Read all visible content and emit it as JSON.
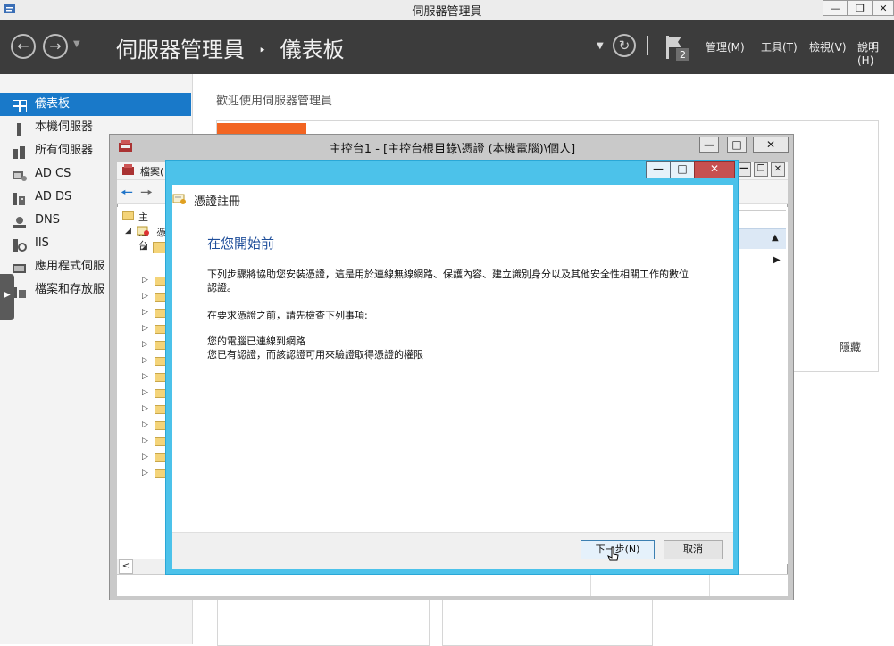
{
  "server_manager": {
    "window_title": "伺服器管理員",
    "breadcrumb_root": "伺服器管理員",
    "breadcrumb_sep": "‣",
    "breadcrumb_current": "儀表板",
    "notification_count": "2",
    "menu": [
      "管理(M)",
      "工具(T)",
      "檢視(V)",
      "說明(H)"
    ],
    "sidebar": [
      {
        "label": "儀表板",
        "icon": "dashboard-icon",
        "active": true
      },
      {
        "label": "本機伺服器",
        "icon": "server-icon"
      },
      {
        "label": "所有伺服器",
        "icon": "servers-icon"
      },
      {
        "label": "AD CS",
        "icon": "ad-cs-icon"
      },
      {
        "label": "AD DS",
        "icon": "ad-ds-icon"
      },
      {
        "label": "DNS",
        "icon": "dns-icon"
      },
      {
        "label": "IIS",
        "icon": "iis-icon"
      },
      {
        "label": "應用程式伺服",
        "icon": "app-server-icon"
      },
      {
        "label": "檔案和存放服",
        "icon": "file-storage-icon"
      }
    ],
    "welcome": "歡迎使用伺服器管理員",
    "hide_link": "隱藏"
  },
  "console": {
    "title": "主控台1 - [主控台根目錄\\憑證 (本機電腦)\\個人]",
    "menu_file": "檔案(",
    "tree_root": "主控台",
    "tree_cert": "憑"
  },
  "wizard": {
    "title": "憑證註冊",
    "heading": "在您開始前",
    "intro": "下列步驟將協助您安裝憑證，這是用於連線無線網路、保護內容、建立識別身分以及其他安全性相關工作的數位認證。",
    "check_intro": "在要求憑證之前，請先檢查下列事項:",
    "checks": [
      "您的電腦已連線到網路",
      "您已有認證，而該認證可用來驗證取得憑證的權限"
    ],
    "next_label": "下一步(N)",
    "cancel_label": "取消"
  }
}
